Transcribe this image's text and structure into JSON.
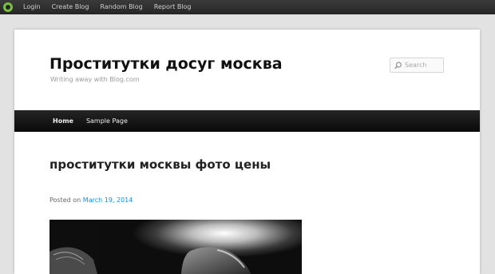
{
  "adminbar": {
    "items": [
      "Login",
      "Create Blog",
      "Random Blog",
      "Report Blog"
    ]
  },
  "site": {
    "title": "Проститутки досуг москва",
    "description": "Writing away with Blog.com"
  },
  "search": {
    "placeholder": "Search"
  },
  "nav": {
    "items": [
      "Home",
      "Sample Page"
    ]
  },
  "post": {
    "title": "проститутки москвы фото цены",
    "posted_on": "Posted on",
    "date": "March 19, 2014"
  },
  "colors": {
    "adminbar": "#262626",
    "logo": "#7ac143",
    "link": "#1b8be0",
    "navbar": "#111111"
  }
}
